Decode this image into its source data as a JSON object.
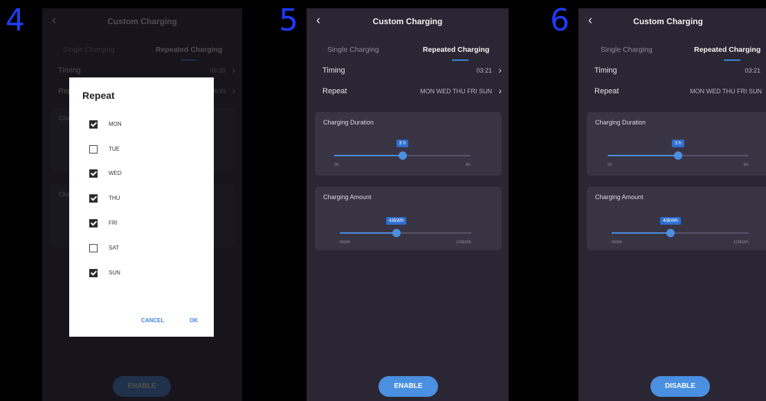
{
  "steps": [
    "4",
    "5",
    "6"
  ],
  "screen": {
    "title": "Custom Charging",
    "tabs": [
      "Single Charging",
      "Repeated Charging"
    ],
    "timing_label": "Timing",
    "repeat_label": "Repeat",
    "colors": {
      "background": "#2b2633",
      "card": "#393443",
      "accent": "#4a8fe0",
      "step_number": "#1f3bff"
    }
  },
  "screen1": {
    "timing_value": "09:20",
    "repeat_value": "MON",
    "duration_label": "Charging Duration",
    "amount_label": "Charging Amount",
    "button": "ENABLE",
    "dialog": {
      "title": "Repeat",
      "days": [
        {
          "label": "MON",
          "checked": true
        },
        {
          "label": "TUE",
          "checked": false
        },
        {
          "label": "WED",
          "checked": true
        },
        {
          "label": "THU",
          "checked": true
        },
        {
          "label": "FRI",
          "checked": true
        },
        {
          "label": "SAT",
          "checked": false
        },
        {
          "label": "SUN",
          "checked": true
        }
      ],
      "cancel": "CANCEL",
      "ok": "OK"
    }
  },
  "screen2": {
    "timing_value": "03:21",
    "repeat_value": "MON WED THU FRI SUN",
    "duration": {
      "label": "Charging Duration",
      "value": "3 h",
      "min": "0h",
      "max": "6h",
      "level": 0.5
    },
    "amount": {
      "label": "Charging Amount",
      "value": "43kWh",
      "min": "0kWh",
      "max": "100kWh",
      "level": 0.43
    },
    "button": "ENABLE"
  },
  "screen3": {
    "timing_value": "03:21",
    "repeat_value": "MON WED THU FRI SUN",
    "duration": {
      "label": "Charging Duration",
      "value": "3 h",
      "min": "0h",
      "max": "6h",
      "level": 0.5
    },
    "amount": {
      "label": "Charging Amount",
      "value": "43kWh",
      "min": "0kWh",
      "max": "100kWh",
      "level": 0.43
    },
    "button": "DISABLE"
  }
}
